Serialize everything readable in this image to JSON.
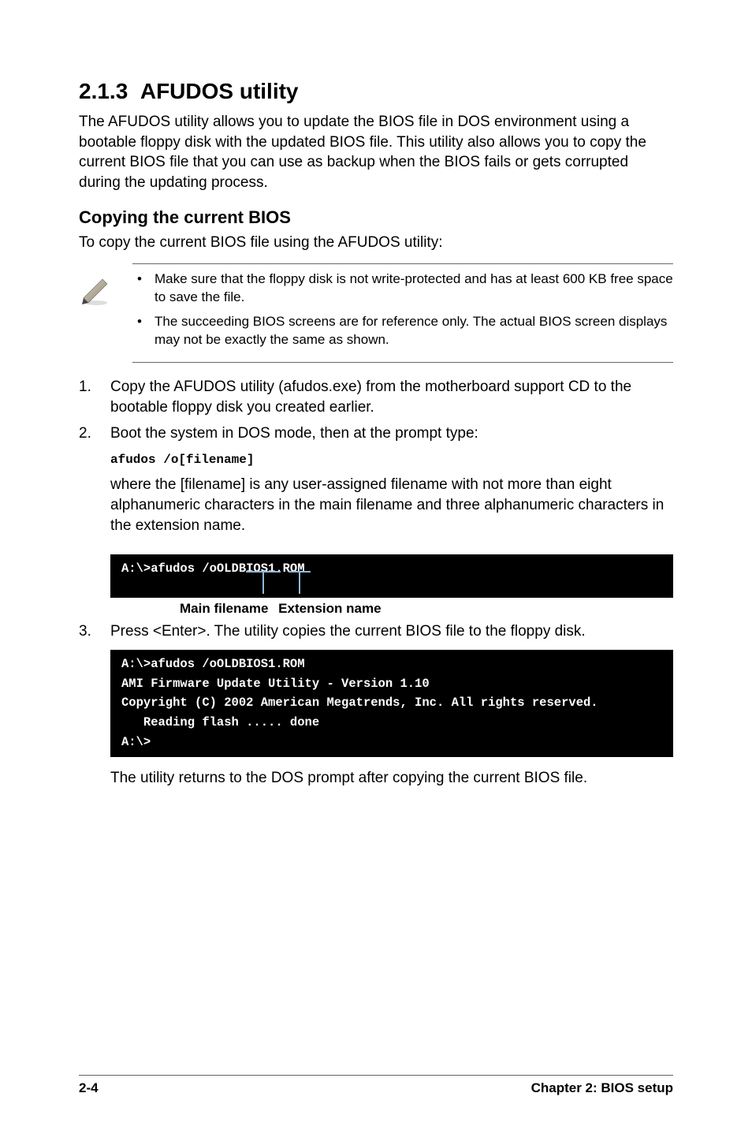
{
  "section": {
    "number": "2.1.3",
    "title": "AFUDOS utility",
    "intro": "The AFUDOS utility allows you to update the BIOS file in DOS environment using a bootable floppy disk with the updated BIOS file. This utility also allows you to copy the current BIOS file that you can use as backup when the BIOS fails or gets corrupted during the updating process."
  },
  "subsection": {
    "title": "Copying the current BIOS",
    "intro": "To copy the current BIOS file using the AFUDOS utility:"
  },
  "notes": [
    "Make sure that the floppy disk is not write-protected and has at least 600 KB free space to save the file.",
    "The succeeding BIOS screens are for reference only. The actual BIOS screen displays may not be exactly the same as shown."
  ],
  "steps": {
    "s1": {
      "num": "1.",
      "text": "Copy the AFUDOS utility (afudos.exe) from the motherboard support CD to the bootable floppy disk you created earlier."
    },
    "s2": {
      "num": "2.",
      "text": "Boot the system in DOS mode, then at the prompt type:",
      "code": "afudos /o[filename]",
      "after": "where the [filename] is any user-assigned filename with not more than eight alphanumeric characters in the main filename and three alphanumeric characters in the extension name."
    },
    "s3": {
      "num": "3.",
      "text": "Press <Enter>. The utility copies the current BIOS file to the floppy disk.",
      "after": "The utility returns to the DOS prompt after copying the current BIOS file."
    }
  },
  "terminal1": "A:\\>afudos /oOLDBIOS1.ROM",
  "labels": {
    "main": "Main filename",
    "ext": "Extension name"
  },
  "terminal2": "A:\\>afudos /oOLDBIOS1.ROM\nAMI Firmware Update Utility - Version 1.10\nCopyright (C) 2002 American Megatrends, Inc. All rights reserved.\n   Reading flash ..... done\nA:\\>",
  "footer": {
    "left": "2-4",
    "right": "Chapter 2: BIOS setup"
  }
}
